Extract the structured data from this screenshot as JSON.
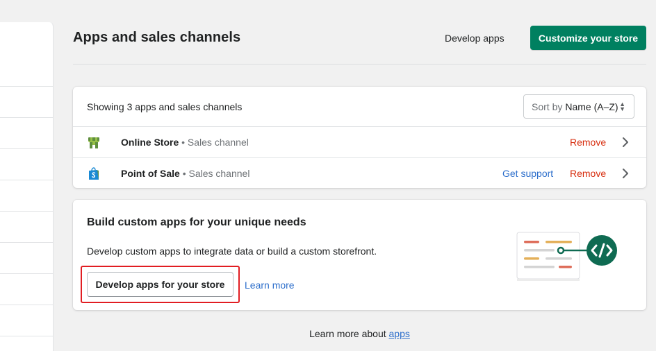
{
  "header": {
    "title": "Apps and sales channels",
    "develop_apps_label": "Develop apps",
    "customize_label": "Customize your store"
  },
  "apps_card": {
    "showing_text": "Showing 3 apps and sales channels",
    "sort": {
      "prefix": "Sort by",
      "value": "Name (A–Z)"
    },
    "apps": [
      {
        "name": "Online Store",
        "type": "• Sales channel",
        "icon": "online-store-icon",
        "remove_label": "Remove"
      },
      {
        "name": "Point of Sale",
        "type": "• Sales channel",
        "icon": "point-of-sale-icon",
        "support_label": "Get support",
        "remove_label": "Remove"
      }
    ]
  },
  "build_card": {
    "title": "Build custom apps for your unique needs",
    "description": "Develop custom apps to integrate data or build a custom storefront.",
    "button_label": "Develop apps for your store",
    "learn_more_label": "Learn more"
  },
  "footer": {
    "prefix": "Learn more about ",
    "link_label": "apps"
  },
  "colors": {
    "primary": "#008060",
    "critical": "#d72c0d",
    "link": "#2c6ecb",
    "highlight": "#e11d22"
  }
}
